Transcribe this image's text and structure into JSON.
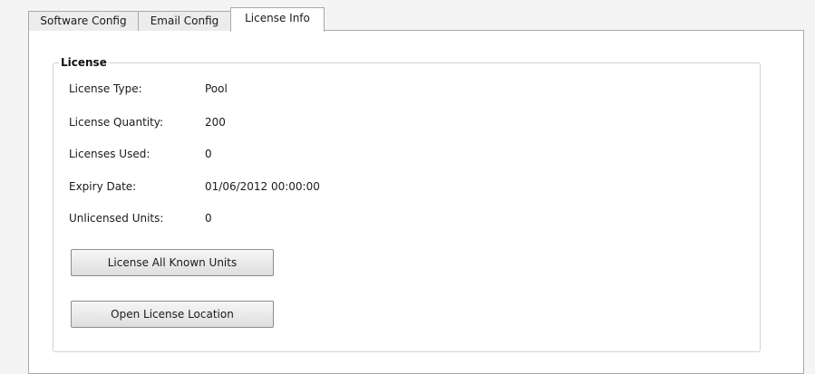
{
  "tabs": [
    {
      "label": "Software Config"
    },
    {
      "label": "Email Config"
    },
    {
      "label": "License Info"
    }
  ],
  "license": {
    "title": "License",
    "fields": [
      {
        "label": "License Type:",
        "value": "Pool"
      },
      {
        "label": "License Quantity:",
        "value": "200"
      },
      {
        "label": "Licenses Used:",
        "value": "0"
      },
      {
        "label": "Expiry Date:",
        "value": "01/06/2012 00:00:00"
      },
      {
        "label": "Unlicensed Units:",
        "value": "0"
      }
    ],
    "buttons": {
      "license_all": "License All Known Units",
      "open_location": "Open License Location"
    }
  }
}
